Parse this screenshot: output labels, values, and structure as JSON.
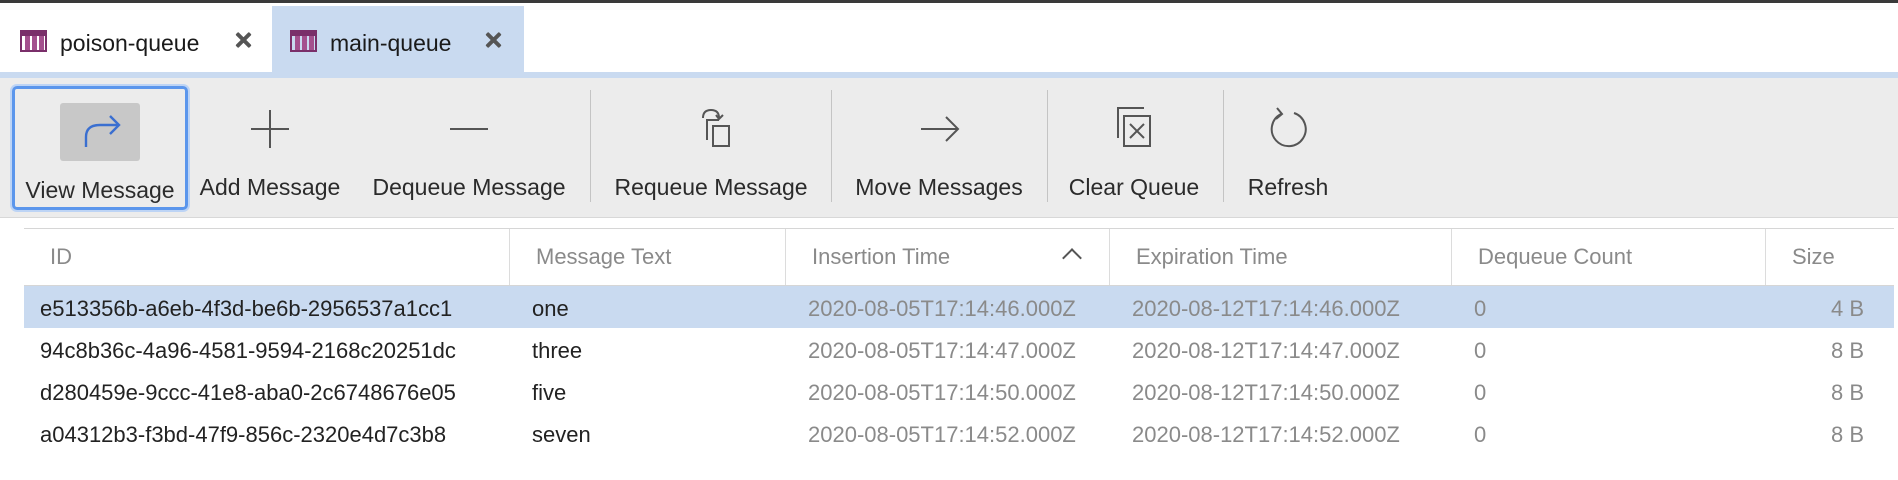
{
  "tabs": [
    {
      "label": "poison-queue",
      "active": false
    },
    {
      "label": "main-queue",
      "active": true
    }
  ],
  "toolbar": {
    "view_message": "View Message",
    "add_message": "Add Message",
    "dequeue_message": "Dequeue Message",
    "requeue_message": "Requeue Message",
    "move_messages": "Move Messages",
    "clear_queue": "Clear Queue",
    "refresh": "Refresh"
  },
  "table": {
    "columns": [
      "ID",
      "Message Text",
      "Insertion Time",
      "Expiration Time",
      "Dequeue Count",
      "Size"
    ],
    "sorted_column": "Insertion Time",
    "sort_direction": "ascending",
    "rows": [
      {
        "id": "e513356b-a6eb-4f3d-be6b-2956537a1cc1",
        "text": "one",
        "insertion": "2020-08-05T17:14:46.000Z",
        "expiration": "2020-08-12T17:14:46.000Z",
        "dequeue_count": "0",
        "size": "4 B",
        "selected": true
      },
      {
        "id": "94c8b36c-4a96-4581-9594-2168c20251dc",
        "text": "three",
        "insertion": "2020-08-05T17:14:47.000Z",
        "expiration": "2020-08-12T17:14:47.000Z",
        "dequeue_count": "0",
        "size": "8 B",
        "selected": false
      },
      {
        "id": "d280459e-9ccc-41e8-aba0-2c6748676e05",
        "text": "five",
        "insertion": "2020-08-05T17:14:50.000Z",
        "expiration": "2020-08-12T17:14:50.000Z",
        "dequeue_count": "0",
        "size": "8 B",
        "selected": false
      },
      {
        "id": "a04312b3-f3bd-47f9-856c-2320e4d7c3b8",
        "text": "seven",
        "insertion": "2020-08-05T17:14:52.000Z",
        "expiration": "2020-08-12T17:14:52.000Z",
        "dequeue_count": "0",
        "size": "8 B",
        "selected": false
      }
    ]
  },
  "colors": {
    "accent": "#c9daf0",
    "focus_ring": "#5b96ec",
    "tab_icon": "#7a2f6a"
  },
  "icons": {
    "tab": "queue-table-icon",
    "view_message": "redirect-arrow-icon",
    "add_message": "plus-icon",
    "dequeue_message": "minus-icon",
    "requeue_message": "requeue-icon",
    "move_messages": "arrow-right-icon",
    "clear_queue": "clear-queue-icon",
    "refresh": "refresh-icon"
  }
}
